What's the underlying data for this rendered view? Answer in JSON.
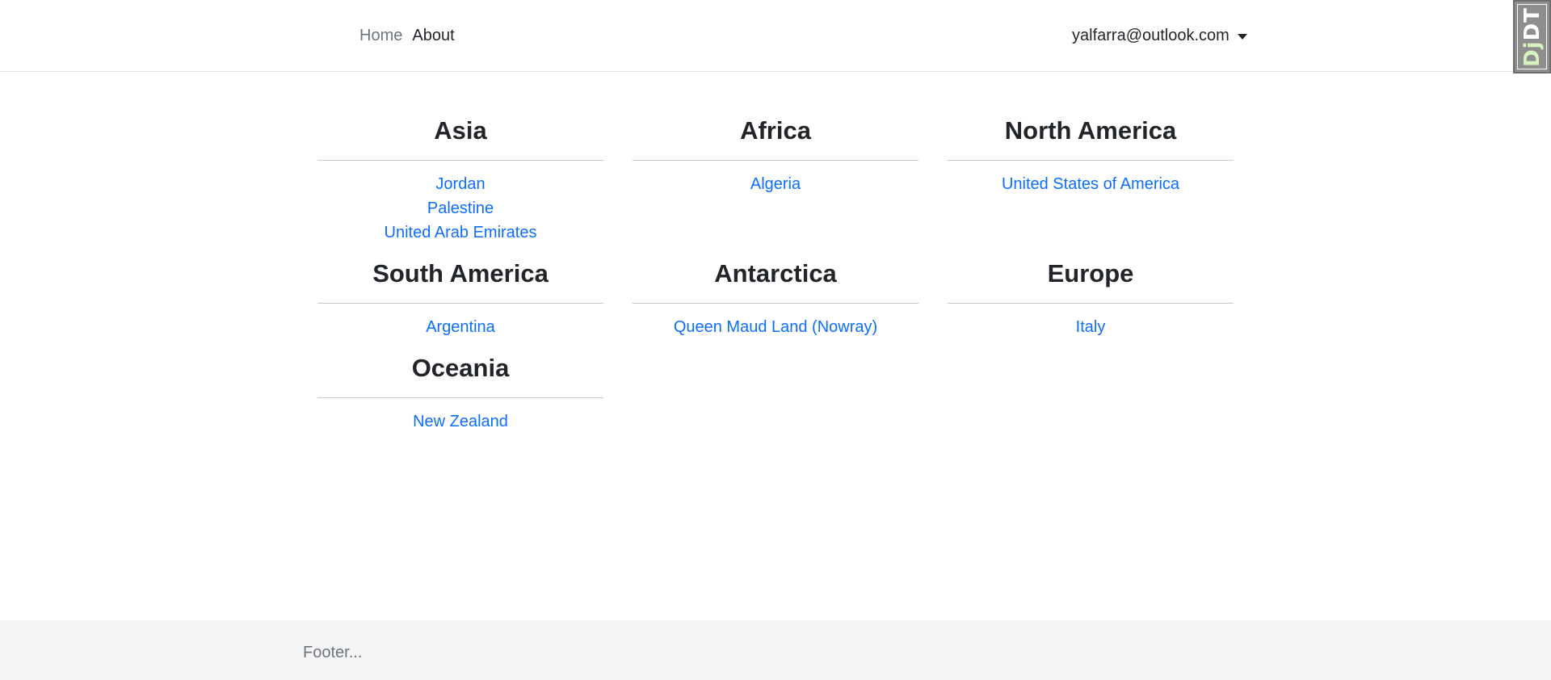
{
  "nav": {
    "links": [
      {
        "label": "Home"
      },
      {
        "label": "About"
      }
    ],
    "user_email": "yalfarra@outlook.com"
  },
  "debug_toolbar": {
    "label_dj": "Dj",
    "label_dt": "DT"
  },
  "continents": [
    {
      "name": "Asia",
      "countries": [
        "Jordan",
        "Palestine",
        "United Arab Emirates"
      ]
    },
    {
      "name": "Africa",
      "countries": [
        "Algeria"
      ]
    },
    {
      "name": "North America",
      "countries": [
        "United States of America"
      ]
    },
    {
      "name": "South America",
      "countries": [
        "Argentina"
      ]
    },
    {
      "name": "Antarctica",
      "countries": [
        "Queen Maud Land (Nowray)"
      ]
    },
    {
      "name": "Europe",
      "countries": [
        "Italy"
      ]
    },
    {
      "name": "Oceania",
      "countries": [
        "New Zealand"
      ]
    }
  ],
  "footer": {
    "text": "Footer..."
  },
  "colors": {
    "link": "#0d6efd",
    "nav_inactive": "#6c757d",
    "footer_bg": "#f5f5f5"
  }
}
